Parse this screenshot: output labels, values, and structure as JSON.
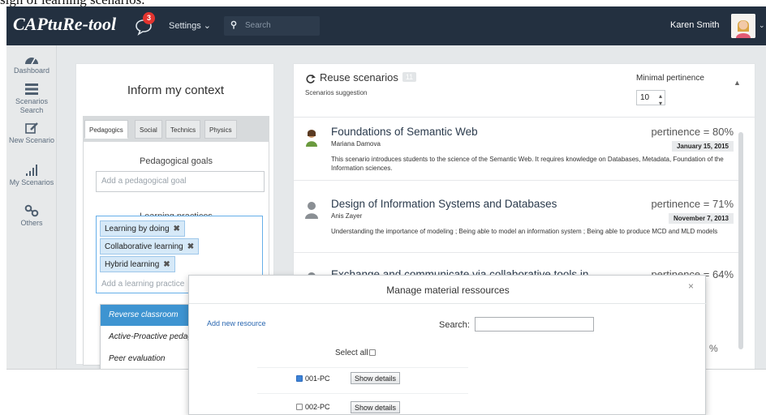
{
  "caption": "sign of learning scenarios.",
  "header": {
    "logo": "CAPtuRe-tool",
    "notification_count": "3",
    "settings_label": "Settings ⌄",
    "search_placeholder": "Search",
    "user_name": "Karen Smith",
    "user_caret": "⌄"
  },
  "sidebar": {
    "items": [
      {
        "label": "Dashboard",
        "icon": "dashboard-icon"
      },
      {
        "label": "Scenarios Search",
        "icon": "list-icon"
      },
      {
        "label": "New Scenario",
        "icon": "edit-icon"
      },
      {
        "label": "My Scenarios",
        "icon": "bar-chart-icon"
      },
      {
        "label": "Others",
        "icon": "link-icon"
      }
    ]
  },
  "context": {
    "title": "Inform my context",
    "tabs": [
      "Pedagogics",
      "Social",
      "Technics",
      "Physics"
    ],
    "pedagogical_goals_label": "Pedagogical goals",
    "goal_placeholder": "Add a pedagogical goal",
    "learning_practices_label": "Learning practices",
    "practice_tags": [
      "Learning by doing",
      "Collaborative learning",
      "Hybrid learning"
    ],
    "practice_placeholder": "Add a learning practice",
    "dropdown_options": [
      "Reverse classroom",
      "Active-Proactive pedagogy",
      "Peer evaluation"
    ]
  },
  "reuse": {
    "title": "Reuse scenarios",
    "count": "11",
    "subtitle": "Scenarios suggestion",
    "min_pertinence_label": "Minimal pertinence",
    "min_pertinence_value": "10",
    "scenarios": [
      {
        "title": "Foundations of Semantic Web",
        "author": "Mariana Damova",
        "pertinence": "pertinence = 80%",
        "date": "January 15, 2015",
        "description": "This scenario introduces students to the science of the Semantic Web. It requires knowledge on Databases, Metadata, Foundation of the Information sciences."
      },
      {
        "title": "Design of Information Systems and Databases",
        "author": "Anis Zayer",
        "pertinence": "pertinence = 71%",
        "date": "November 7, 2013",
        "description": "Understanding the importance of modeling ; Being able to model an information system ; Being able to produce MCD and MLD models"
      },
      {
        "title": "Exchange and communicate via collaborative tools in",
        "author": "",
        "pertinence": "pertinence = 64%",
        "date": "",
        "description": ""
      }
    ],
    "stray_percent": "%"
  },
  "modal": {
    "title": "Manage material ressources",
    "close": "×",
    "add_link": "Add new resource",
    "search_label": "Search:",
    "select_all": "Select all",
    "resources": [
      {
        "id": "001-PC",
        "checked": true,
        "button": "Show details"
      },
      {
        "id": "002-PC",
        "checked": false,
        "button": "Show details"
      }
    ]
  },
  "colors": {
    "topbar": "#233040",
    "accent": "#3e94d1",
    "badge": "#e3342f"
  }
}
